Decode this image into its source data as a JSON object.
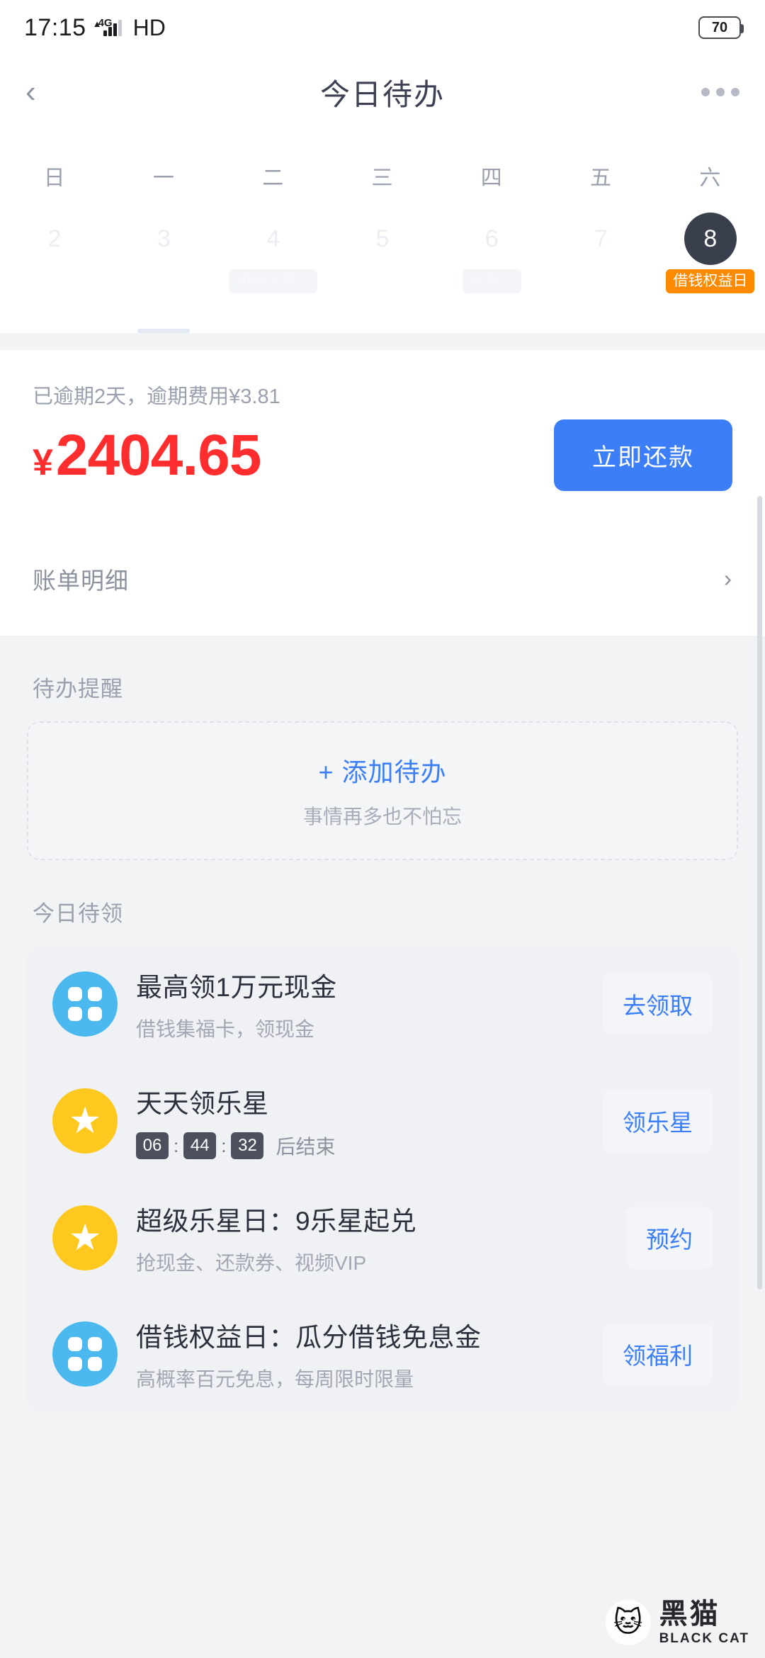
{
  "status_bar": {
    "time": "17:15",
    "network": "4G",
    "hd_label": "HD",
    "battery": "70"
  },
  "nav": {
    "back_icon": "chevron-left-icon",
    "title": "今日待办",
    "more_icon": "more-horizontal-icon"
  },
  "calendar": {
    "weekdays": [
      "日",
      "一",
      "二",
      "三",
      "四",
      "五",
      "六"
    ],
    "days": [
      {
        "num": "2",
        "tag": "",
        "selected": false,
        "faded": true,
        "bar": false
      },
      {
        "num": "3",
        "tag": "",
        "selected": false,
        "faded": true,
        "bar": true
      },
      {
        "num": "4",
        "tag": "超级乐星日",
        "tag_style": "ghost",
        "selected": false,
        "faded": true,
        "bar": false
      },
      {
        "num": "5",
        "tag": "",
        "selected": false,
        "faded": true,
        "bar": false
      },
      {
        "num": "6",
        "tag": "还款日",
        "tag_style": "ghost",
        "selected": false,
        "faded": true,
        "bar": false
      },
      {
        "num": "7",
        "tag": "",
        "selected": false,
        "faded": true,
        "bar": false
      },
      {
        "num": "8",
        "tag": "借钱权益日",
        "tag_style": "orange",
        "selected": true,
        "faded": false,
        "bar": false
      }
    ]
  },
  "bill": {
    "overdue_note": "已逾期2天，逾期费用¥3.81",
    "currency": "¥",
    "amount": "2404.65",
    "repay_button": "立即还款",
    "detail_label": "账单明细",
    "detail_chevron": "chevron-right-icon",
    "amount_color": "#ff2d2d",
    "button_color": "#3b7ef7"
  },
  "todo": {
    "section_title": "待办提醒",
    "add_label": "+ 添加待办",
    "add_sub": "事情再多也不怕忘"
  },
  "rewards": {
    "section_title": "今日待领",
    "items": [
      {
        "icon": "clover-icon",
        "icon_color": "#4bb9f0",
        "title": "最高领1万元现金",
        "subtitle": "借钱集福卡，领现金",
        "action": "去领取"
      },
      {
        "icon": "star-icon",
        "icon_color": "#ffc81f",
        "title": "天天领乐星",
        "timer": {
          "hours": "06",
          "minutes": "44",
          "seconds": "32",
          "suffix": "后结束"
        },
        "action": "领乐星"
      },
      {
        "icon": "star-icon",
        "icon_color": "#ffc81f",
        "title": "超级乐星日：9乐星起兑",
        "subtitle": "抢现金、还款券、视频VIP",
        "action": "预约"
      },
      {
        "icon": "clover-icon",
        "icon_color": "#4bb9f0",
        "title": "借钱权益日：瓜分借钱免息金",
        "subtitle": "高概率百元免息，每周限时限量",
        "action": "领福利"
      }
    ]
  },
  "watermark": {
    "cat_icon": "cat-icon",
    "cn": "黑猫",
    "en": "BLACK CAT"
  }
}
